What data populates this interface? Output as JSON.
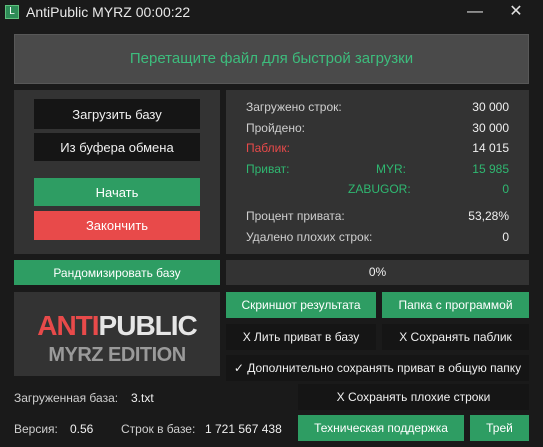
{
  "window": {
    "title": "AntiPublic MYRZ 00:00:22",
    "minimize_label": "—",
    "close_label": "✕",
    "icon": "app-icon"
  },
  "drop_zone": {
    "text": "Перетащите файл для быстрой загрузки"
  },
  "buttons": {
    "load_base": "Загрузить базу",
    "from_clipboard": "Из буфера обмена",
    "start": "Начать",
    "finish": "Закончить",
    "randomize": "Рандомизировать базу",
    "screenshot": "Скриншот результата",
    "open_folder": "Папка с программой",
    "pour_private": "X Лить приват в базу",
    "save_public": "X Сохранять паблик",
    "extra_save_private": "✓ Дополнительно сохранять приват в общую папку",
    "save_bad_lines": "X Сохранять плохие строки",
    "support": "Техническая поддержка",
    "tray": "Трей"
  },
  "stats": {
    "loaded_lines_label": "Загружено строк:",
    "loaded_lines_value": "30 000",
    "passed_label": "Пройдено:",
    "passed_value": "30 000",
    "public_label": "Паблик:",
    "public_value": "14 015",
    "private_label": "Приват:",
    "private_myr_label": "MYR:",
    "private_myr_value": "15 985",
    "zabugor_label": "ZABUGOR:",
    "zabugor_value": "0",
    "private_percent_label": "Процент привата:",
    "private_percent_value": "53,28%",
    "removed_bad_label": "Удалено плохих строк:",
    "removed_bad_value": "0"
  },
  "progress": {
    "text": "0%",
    "value": 0
  },
  "logo": {
    "anti": "ANTI",
    "public": "PUBLIC",
    "edition": "MYRZ EDITION"
  },
  "footer": {
    "loaded_base_label": "Загруженная база:",
    "loaded_base_value": "3.txt",
    "version_label": "Версия:",
    "version_value": "0.56",
    "lines_in_base_label": "Строк в базе:",
    "lines_in_base_value": "1 721 567 438"
  },
  "colors": {
    "accent_green": "#2e9d63",
    "accent_red": "#e84a4a",
    "text_green": "#2fb871",
    "background": "#1a1a1a",
    "panel": "#333333"
  }
}
